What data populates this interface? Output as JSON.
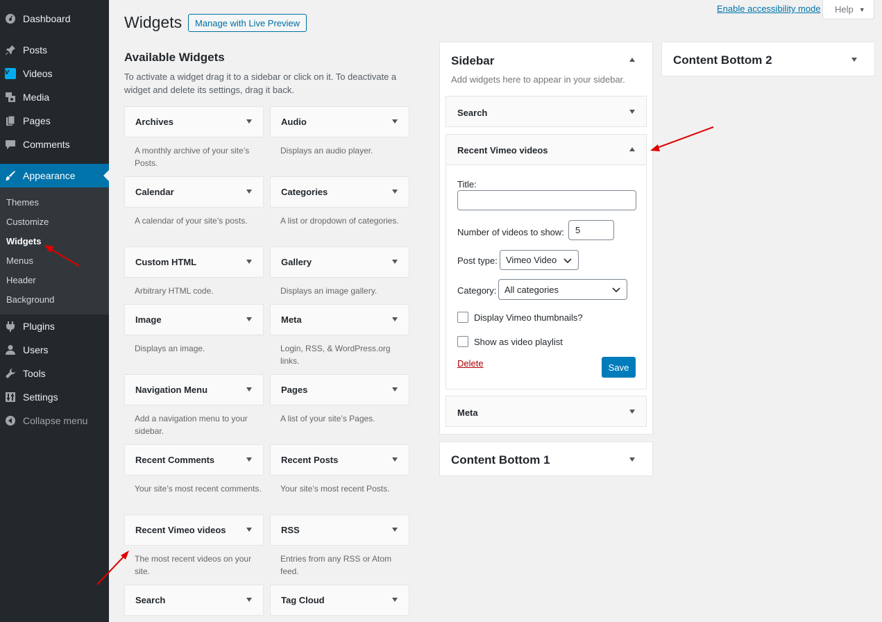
{
  "menu": {
    "dashboard": "Dashboard",
    "posts": "Posts",
    "videos": "Videos",
    "media": "Media",
    "pages": "Pages",
    "comments": "Comments",
    "appearance": "Appearance",
    "plugins": "Plugins",
    "users": "Users",
    "tools": "Tools",
    "settings": "Settings",
    "collapse": "Collapse menu",
    "submenu": [
      "Themes",
      "Customize",
      "Widgets",
      "Menus",
      "Header",
      "Background"
    ]
  },
  "header": {
    "title": "Widgets",
    "live_preview": "Manage with Live Preview",
    "accessibility": "Enable accessibility mode",
    "help": "Help"
  },
  "available": {
    "heading": "Available Widgets",
    "description": "To activate a widget drag it to a sidebar or click on it. To deactivate a widget and delete its settings, drag it back.",
    "widgets": [
      {
        "name": "Archives",
        "desc": "A monthly archive of your site’s Posts."
      },
      {
        "name": "Audio",
        "desc": "Displays an audio player."
      },
      {
        "name": "Calendar",
        "desc": "A calendar of your site’s posts."
      },
      {
        "name": "Categories",
        "desc": "A list or dropdown of categories."
      },
      {
        "name": "Custom HTML",
        "desc": "Arbitrary HTML code."
      },
      {
        "name": "Gallery",
        "desc": "Displays an image gallery."
      },
      {
        "name": "Image",
        "desc": "Displays an image."
      },
      {
        "name": "Meta",
        "desc": "Login, RSS, & WordPress.org links."
      },
      {
        "name": "Navigation Menu",
        "desc": "Add a navigation menu to your sidebar."
      },
      {
        "name": "Pages",
        "desc": "A list of your site’s Pages."
      },
      {
        "name": "Recent Comments",
        "desc": "Your site’s most recent comments."
      },
      {
        "name": "Recent Posts",
        "desc": "Your site’s most recent Posts."
      },
      {
        "name": "Recent Vimeo videos",
        "desc": "The most recent videos on your site."
      },
      {
        "name": "RSS",
        "desc": "Entries from any RSS or Atom feed."
      },
      {
        "name": "Search",
        "desc": ""
      },
      {
        "name": "Tag Cloud",
        "desc": ""
      }
    ]
  },
  "sidebar": {
    "title": "Sidebar",
    "description": "Add widgets here to appear in your sidebar.",
    "search": "Search",
    "open_widget": {
      "title": "Recent Vimeo videos",
      "title_label": "Title:",
      "title_value": "",
      "num_label": "Number of videos to show:",
      "num_value": "5",
      "post_type_label": "Post type:",
      "post_type_value": "Vimeo Video",
      "category_label": "Category:",
      "category_value": "All categories",
      "thumbs_label": "Display Vimeo thumbnails?",
      "playlist_label": "Show as video playlist",
      "delete": "Delete",
      "save": "Save"
    },
    "meta": "Meta"
  },
  "areas": {
    "content_bottom_1": "Content Bottom 1",
    "content_bottom_2": "Content Bottom 2"
  },
  "colors": {
    "menu_bg": "#23282d",
    "accent": "#0073aa",
    "annotation_arrow": "#e00000"
  }
}
